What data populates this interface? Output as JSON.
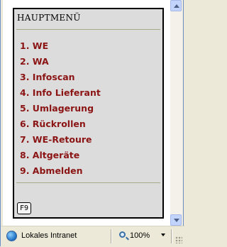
{
  "app": {
    "title": "HAUPTMENÜ",
    "menu": [
      {
        "label": "1. WE"
      },
      {
        "label": "2. WA"
      },
      {
        "label": "3. Infoscan"
      },
      {
        "label": "4. Info Lieferant"
      },
      {
        "label": "5. Umlagerung"
      },
      {
        "label": "6. Rückrollen"
      },
      {
        "label": "7. WE-Retoure"
      },
      {
        "label": "8. Altgeräte"
      },
      {
        "label": "9. Abmelden"
      }
    ],
    "f9_label": "F9",
    "accent_color": "#8b1414"
  },
  "statusbar": {
    "zone_icon": "globe-icon",
    "zone_text": "Lokales Intranet",
    "zoom_icon": "magnifier-icon",
    "zoom_text": "100%"
  }
}
